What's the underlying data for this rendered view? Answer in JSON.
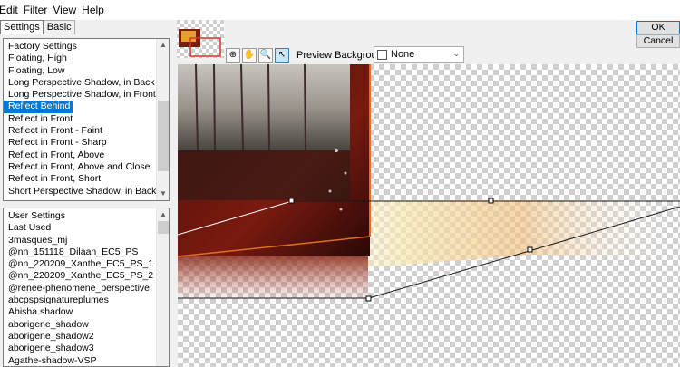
{
  "menu": [
    "Edit",
    "Filter",
    "View",
    "Help"
  ],
  "tabs": [
    {
      "label": "Settings"
    },
    {
      "label": "Basic"
    }
  ],
  "presets": {
    "items": [
      "Factory Settings",
      "Floating, High",
      "Floating, Low",
      "Long Perspective Shadow, in Back",
      "Long Perspective Shadow, in Front",
      "Reflect Behind",
      "Reflect in Front",
      "Reflect in Front - Faint",
      "Reflect in Front - Sharp",
      "Reflect in Front, Above",
      "Reflect in Front, Above and Close",
      "Reflect in Front, Short",
      "Short Perspective Shadow, in Back"
    ],
    "selected": "Reflect Behind"
  },
  "user_settings": {
    "items": [
      "User Settings",
      "Last Used",
      "3masques_mj",
      "@nn_151118_Dilaan_EC5_PS",
      "@nn_220209_Xanthe_EC5_PS_1",
      "@nn_220209_Xanthe_EC5_PS_2",
      "@renee-phenomene_perspective",
      "abcpspsignatureplumes",
      "Abisha shadow",
      "aborigene_shadow",
      "aborigene_shadow2",
      "aborigene_shadow3",
      "Agathe-shadow-VSP"
    ]
  },
  "toolbar": {
    "tools": [
      {
        "icon": "navigate-icon",
        "glyph": "⊕"
      },
      {
        "icon": "hand-icon",
        "glyph": "✋"
      },
      {
        "icon": "zoom-icon",
        "glyph": "🔍"
      },
      {
        "icon": "pointer-icon",
        "glyph": "↖"
      }
    ],
    "preview_background_label": "Preview Background:",
    "preview_background_value": "None"
  },
  "buttons": {
    "ok": "OK",
    "cancel": "Cancel"
  }
}
